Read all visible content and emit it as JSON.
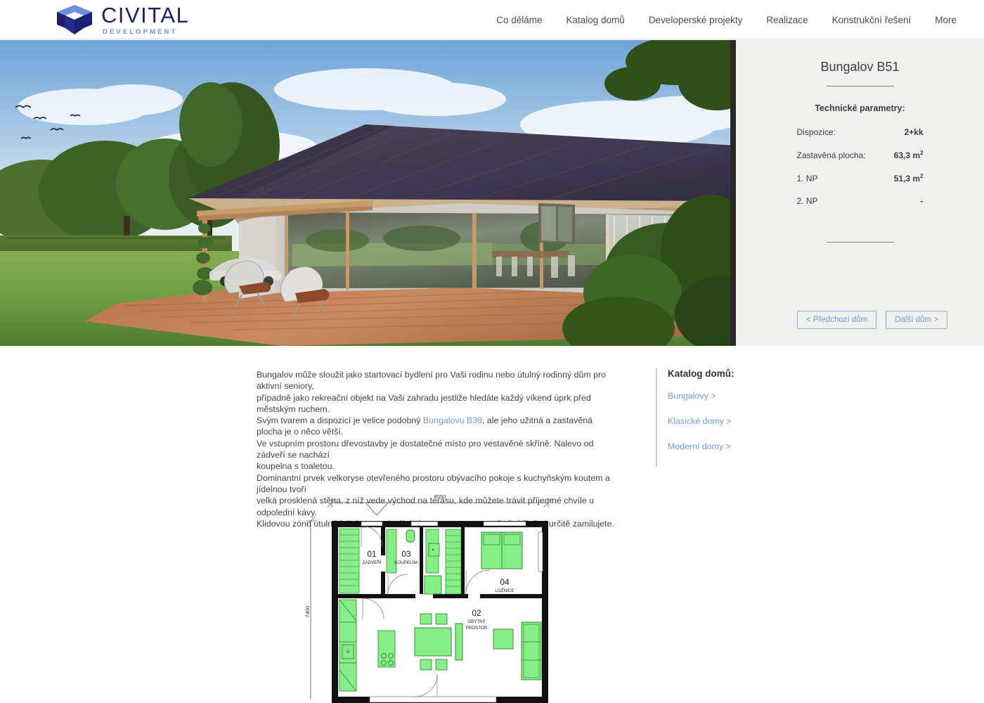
{
  "brand": {
    "name": "CIVITAL",
    "tagline": "DEVELOPMENT",
    "logo_icon": "cube-logo-icon",
    "colors": {
      "dark": "#1a1f6e",
      "light": "#6f8fe0"
    }
  },
  "nav": {
    "items": [
      {
        "label": "Co děláme"
      },
      {
        "label": "Katalog domů"
      },
      {
        "label": "Developerské projekty"
      },
      {
        "label": "Realizace"
      },
      {
        "label": "Konstrukční řešení"
      },
      {
        "label": "More"
      }
    ]
  },
  "hero": {
    "alt": "Bungalow exterior render with terrace, garden and hedge"
  },
  "info": {
    "title": "Bungalov B51",
    "subtitle": "Technické parametry:",
    "specs": [
      {
        "label": "Dispozice:",
        "value": "2+kk",
        "unit": ""
      },
      {
        "label": "Zastavěná plocha:",
        "value": "63,3 m",
        "unit": "2"
      },
      {
        "label": "1. NP",
        "value": "51,3 m",
        "unit": "2"
      },
      {
        "label": "2. NP",
        "value": "-",
        "unit": ""
      }
    ],
    "prev_button": "< Předchozí dům",
    "next_button": "Další dům >",
    "accent_color": "#8ab0ef"
  },
  "description": {
    "line1": "Bungalov může sloužit jako startovací bydlení pro Vaši rodinu nebo útulný rodinný dům pro aktivní seniory,",
    "line2": "případně jako rekreační objekt na Vaši zahradu jestliže hledáte každý víkend úprk před městským ruchem.",
    "line3_a": "Svým tvarem a dispozicí je velice podobný ",
    "line3_link": "Bungalovu B39",
    "line3_b": ", ale jeho užitná a zastavěná plocha je o něco větší.",
    "line4": "Ve vstupním prostoru dřevostavby je dostatečné místo pro vestavěné skříně. Nalevo od zádveří se nachází",
    "line5": "koupelna s toaletou.",
    "line6": "Dominantní prvek velkoryse otevřeného prostoru obývacího pokoje s kuchyňským koutem a jídelnou tvoří",
    "line7": "velká prosklená stěna, z níž vede východ na terasu, kde můžete trávit příjemné chvíle u odpolední kávy.",
    "line8": "Klidovou zónu útulné ložnice s optimálními prostory pro vestavěné skříně si určitě zamilujete."
  },
  "catalog": {
    "title": "Katalog domů:",
    "links": [
      {
        "label": "Bungalovy >"
      },
      {
        "label": "Klasické domy >"
      },
      {
        "label": "Moderní domy >"
      }
    ]
  },
  "floorplan": {
    "dim_width": "8550",
    "dim_height": "7400",
    "rooms": [
      {
        "number": "01",
        "name": "ZÁDVEŘÍ"
      },
      {
        "number": "03",
        "name": "KOUPELNA"
      },
      {
        "number": "04",
        "name": "LOŽNICE"
      },
      {
        "number": "02",
        "name": "OBYTNÝ",
        "name2": "PROSTOR"
      }
    ],
    "furniture_color": "#86ee86"
  }
}
